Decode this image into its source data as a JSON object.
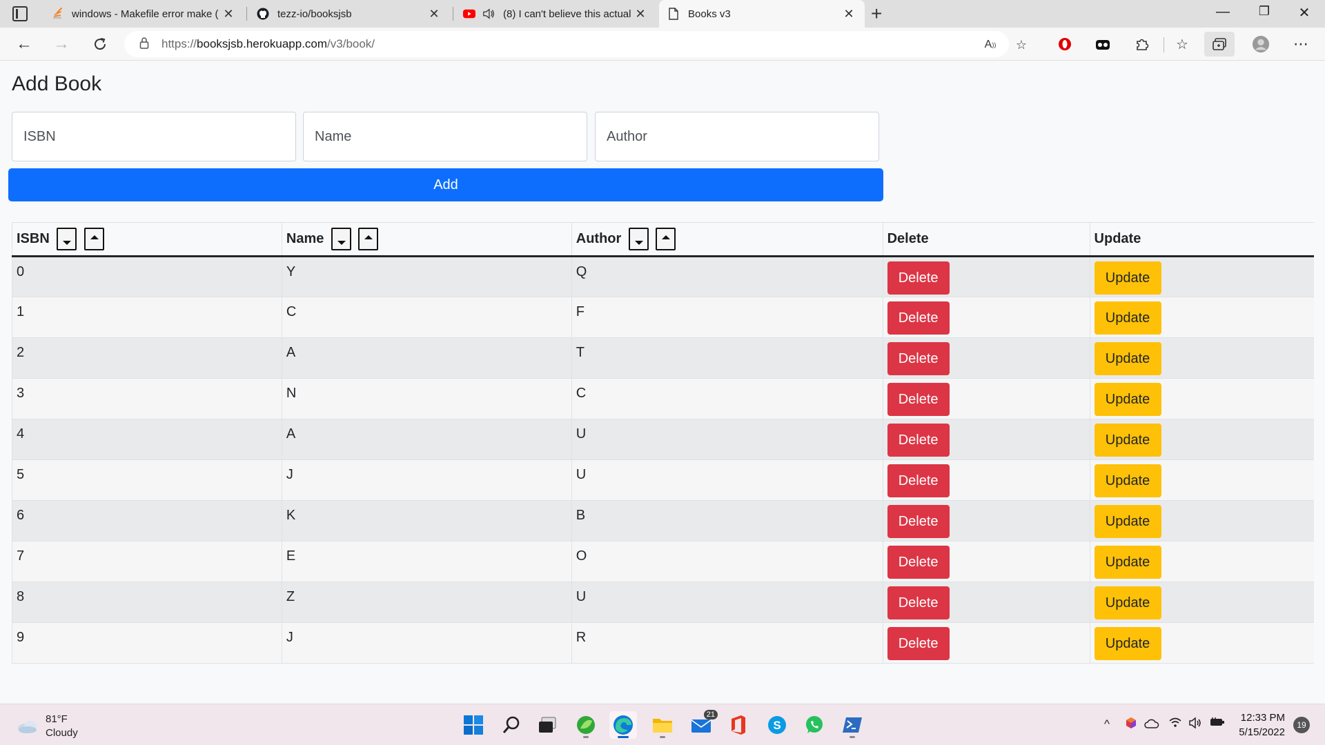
{
  "browser": {
    "tabs": [
      {
        "title": "windows - Makefile error make (",
        "active": false
      },
      {
        "title": "tezz-io/booksjsb",
        "active": false
      },
      {
        "title": "(8) I can't believe this actual",
        "active": false
      },
      {
        "title": "Books v3",
        "active": true
      }
    ],
    "url_prefix": "https://",
    "url_host": "booksjsb.herokuapp.com",
    "url_path": "/v3/book/"
  },
  "page": {
    "title": "Add Book",
    "form": {
      "isbn_placeholder": "ISBN",
      "name_placeholder": "Name",
      "author_placeholder": "Author",
      "add_label": "Add"
    },
    "table": {
      "headers": {
        "isbn": "ISBN",
        "name": "Name",
        "author": "Author",
        "delete": "Delete",
        "update": "Update"
      },
      "delete_label": "Delete",
      "update_label": "Update",
      "rows": [
        {
          "isbn": "0",
          "name": "Y",
          "author": "Q"
        },
        {
          "isbn": "1",
          "name": "C",
          "author": "F"
        },
        {
          "isbn": "2",
          "name": "A",
          "author": "T"
        },
        {
          "isbn": "3",
          "name": "N",
          "author": "C"
        },
        {
          "isbn": "4",
          "name": "A",
          "author": "U"
        },
        {
          "isbn": "5",
          "name": "J",
          "author": "U"
        },
        {
          "isbn": "6",
          "name": "K",
          "author": "B"
        },
        {
          "isbn": "7",
          "name": "E",
          "author": "O"
        },
        {
          "isbn": "8",
          "name": "Z",
          "author": "U"
        },
        {
          "isbn": "9",
          "name": "J",
          "author": "R"
        }
      ]
    }
  },
  "taskbar": {
    "weather_temp": "81°F",
    "weather_desc": "Cloudy",
    "mail_badge": "21",
    "time": "12:33 PM",
    "date": "5/15/2022",
    "notifications": "19"
  },
  "colors": {
    "primary": "#0d6efd",
    "danger": "#dc3545",
    "warning": "#ffc107"
  }
}
